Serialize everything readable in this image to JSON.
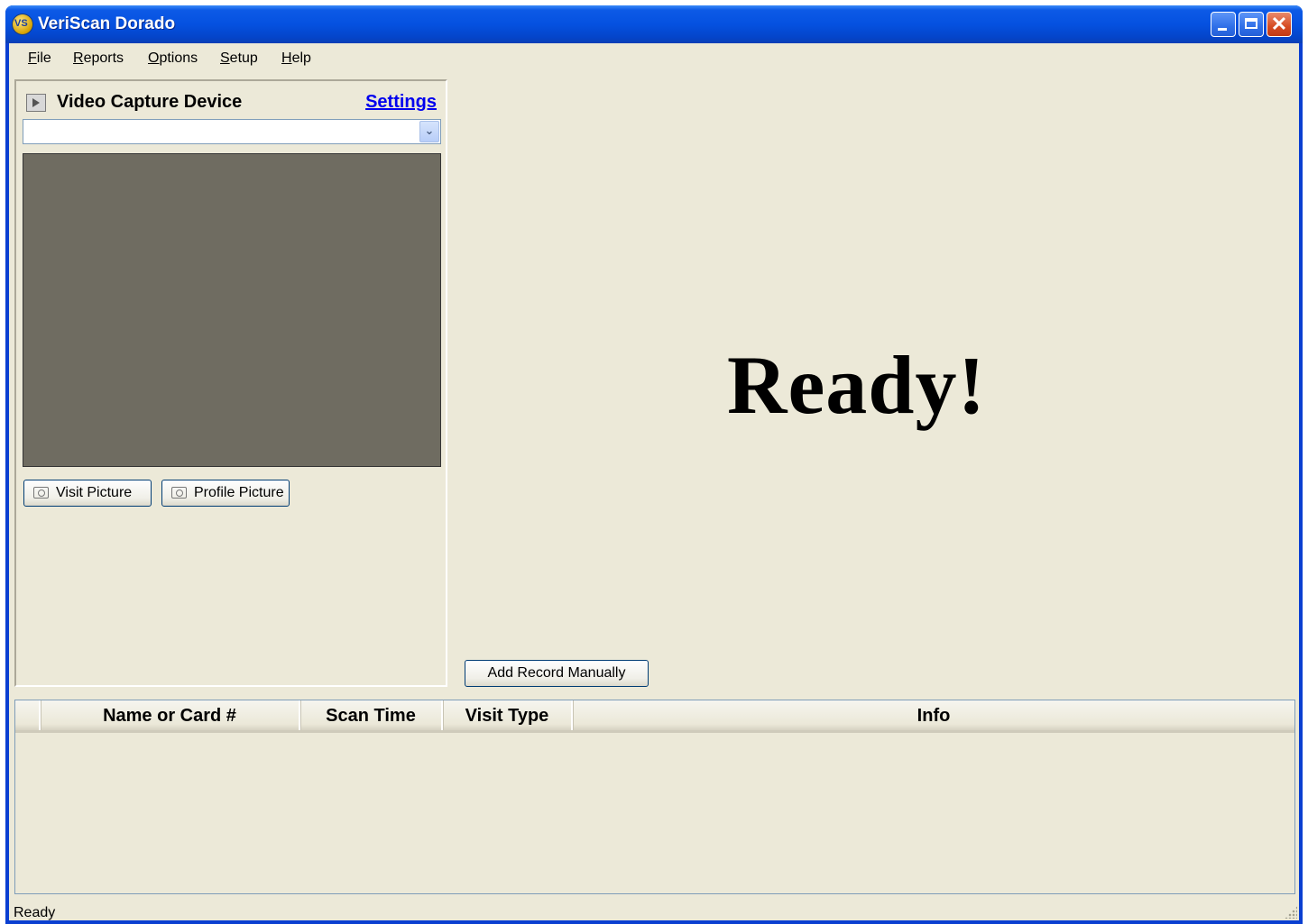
{
  "window": {
    "title": "VeriScan Dorado",
    "app_icon_text": "VS"
  },
  "menu": {
    "items": [
      {
        "label": "File"
      },
      {
        "label": "Reports"
      },
      {
        "label": "Options"
      },
      {
        "label": "Setup"
      },
      {
        "label": "Help"
      }
    ]
  },
  "capture_panel": {
    "title": "Video Capture Device",
    "settings_label": "Settings",
    "device_value": "",
    "visit_picture_label": "Visit Picture",
    "profile_picture_label": "Profile Picture"
  },
  "main": {
    "status_big": "Ready!",
    "add_record_label": "Add Record Manually"
  },
  "table": {
    "columns": [
      "",
      "Name or Card #",
      "Scan Time",
      "Visit Type",
      "Info"
    ],
    "rows": []
  },
  "statusbar": {
    "text": "Ready"
  },
  "colors": {
    "titlebar": "#0551e0",
    "window_bg": "#ece9d8",
    "video_bg": "#6f6c61",
    "link": "#0000ee"
  }
}
